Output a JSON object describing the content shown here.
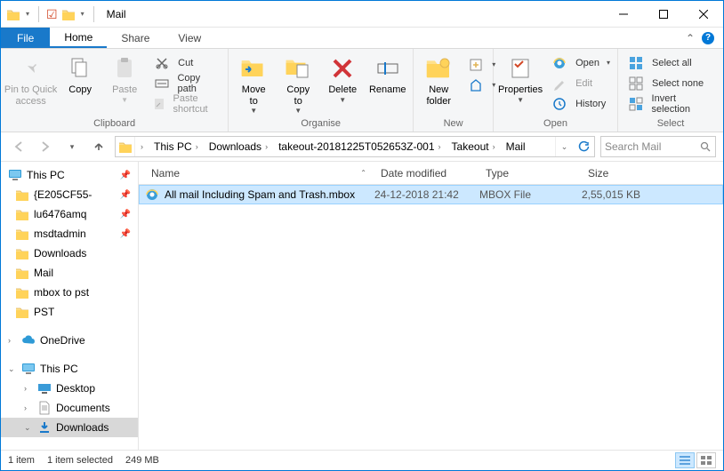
{
  "window_title": "Mail",
  "tabs": {
    "file": "File",
    "home": "Home",
    "share": "Share",
    "view": "View",
    "active": "Home"
  },
  "ribbon": {
    "clipboard": {
      "label": "Clipboard",
      "pin": "Pin to Quick\naccess",
      "copy": "Copy",
      "paste": "Paste",
      "cut": "Cut",
      "copy_path": "Copy path",
      "paste_shortcut": "Paste shortcut"
    },
    "organise": {
      "label": "Organise",
      "move_to": "Move\nto",
      "copy_to": "Copy\nto",
      "delete": "Delete",
      "rename": "Rename"
    },
    "new": {
      "label": "New",
      "new_folder": "New\nfolder"
    },
    "open": {
      "label": "Open",
      "properties": "Properties",
      "open": "Open",
      "edit": "Edit",
      "history": "History"
    },
    "select": {
      "label": "Select",
      "select_all": "Select all",
      "select_none": "Select none",
      "invert": "Invert selection"
    }
  },
  "breadcrumb": {
    "items": [
      "This PC",
      "Downloads",
      "takeout-20181225T052653Z-001",
      "Takeout",
      "Mail"
    ]
  },
  "search_placeholder": "Search Mail",
  "tree": {
    "thispc_root": "This PC",
    "items": [
      {
        "label": "{E205CF55-",
        "pin": true
      },
      {
        "label": "lu6476amq",
        "pin": true
      },
      {
        "label": "msdtadmin",
        "pin": true
      },
      {
        "label": "Downloads"
      },
      {
        "label": "Mail"
      },
      {
        "label": "mbox to pst"
      },
      {
        "label": "PST"
      }
    ],
    "onedrive": "OneDrive",
    "thispc2": "This PC",
    "desktop": "Desktop",
    "documents": "Documents",
    "downloads_sel": "Downloads"
  },
  "columns": {
    "name": "Name",
    "date": "Date modified",
    "type": "Type",
    "size": "Size"
  },
  "files": [
    {
      "name": "All mail Including Spam and Trash.mbox",
      "date": "24-12-2018 21:42",
      "type": "MBOX File",
      "size": "2,55,015 KB",
      "selected": true
    }
  ],
  "status": {
    "count": "1 item",
    "selected": "1 item selected",
    "size": "249 MB"
  }
}
